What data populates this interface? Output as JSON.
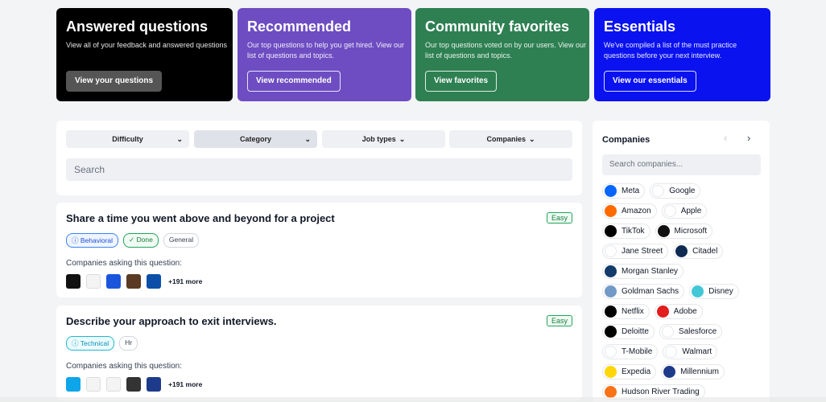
{
  "cards": [
    {
      "title": "Answered questions",
      "desc": "View all of your feedback and answered questions",
      "button": "View your questions"
    },
    {
      "title": "Recommended",
      "desc": "Our top questions to help you get hired. View our list of questions and topics.",
      "button": "View recommended"
    },
    {
      "title": "Community favorites",
      "desc": "Our top questions voted on by our users. View our list of questions and topics.",
      "button": "View favorites"
    },
    {
      "title": "Essentials",
      "desc": "We've compiled a list of the must practice questions before your next interview.",
      "button": "View our essentials"
    }
  ],
  "filters": [
    "Difficulty",
    "Category",
    "Job types",
    "Companies"
  ],
  "search_placeholder": "Search",
  "questions": [
    {
      "title": "Share a time you went above and beyond for a project",
      "difficulty": "Easy",
      "tags": [
        "Behavioral",
        "Done",
        "General"
      ],
      "asking_label": "Companies asking this question:",
      "more": "+191 more"
    },
    {
      "title": "Describe your approach to exit interviews.",
      "difficulty": "Easy",
      "tags": [
        "Technical",
        "Hr"
      ],
      "asking_label": "Companies asking this question:",
      "more": "+191 more"
    }
  ],
  "companies_panel": {
    "title": "Companies",
    "search_placeholder": "Search companies...",
    "chips": [
      [
        "Meta",
        "Google"
      ],
      [
        "Amazon",
        "Apple"
      ],
      [
        "TikTok",
        "Microsoft"
      ],
      [
        "Jane Street",
        "Citadel"
      ],
      [
        "Morgan Stanley"
      ],
      [
        "Goldman Sachs",
        "Disney"
      ],
      [
        "Netflix",
        "Adobe"
      ],
      [
        "Deloitte",
        "Salesforce"
      ],
      [
        "T-Mobile",
        "Walmart"
      ],
      [
        "Expedia",
        "Millennium"
      ],
      [
        "Hudson River Trading"
      ]
    ]
  },
  "colors": {
    "answered": "#000000",
    "recommended": "#6e4dc2",
    "favorites": "#2e8052",
    "essentials": "#0b12f0"
  }
}
